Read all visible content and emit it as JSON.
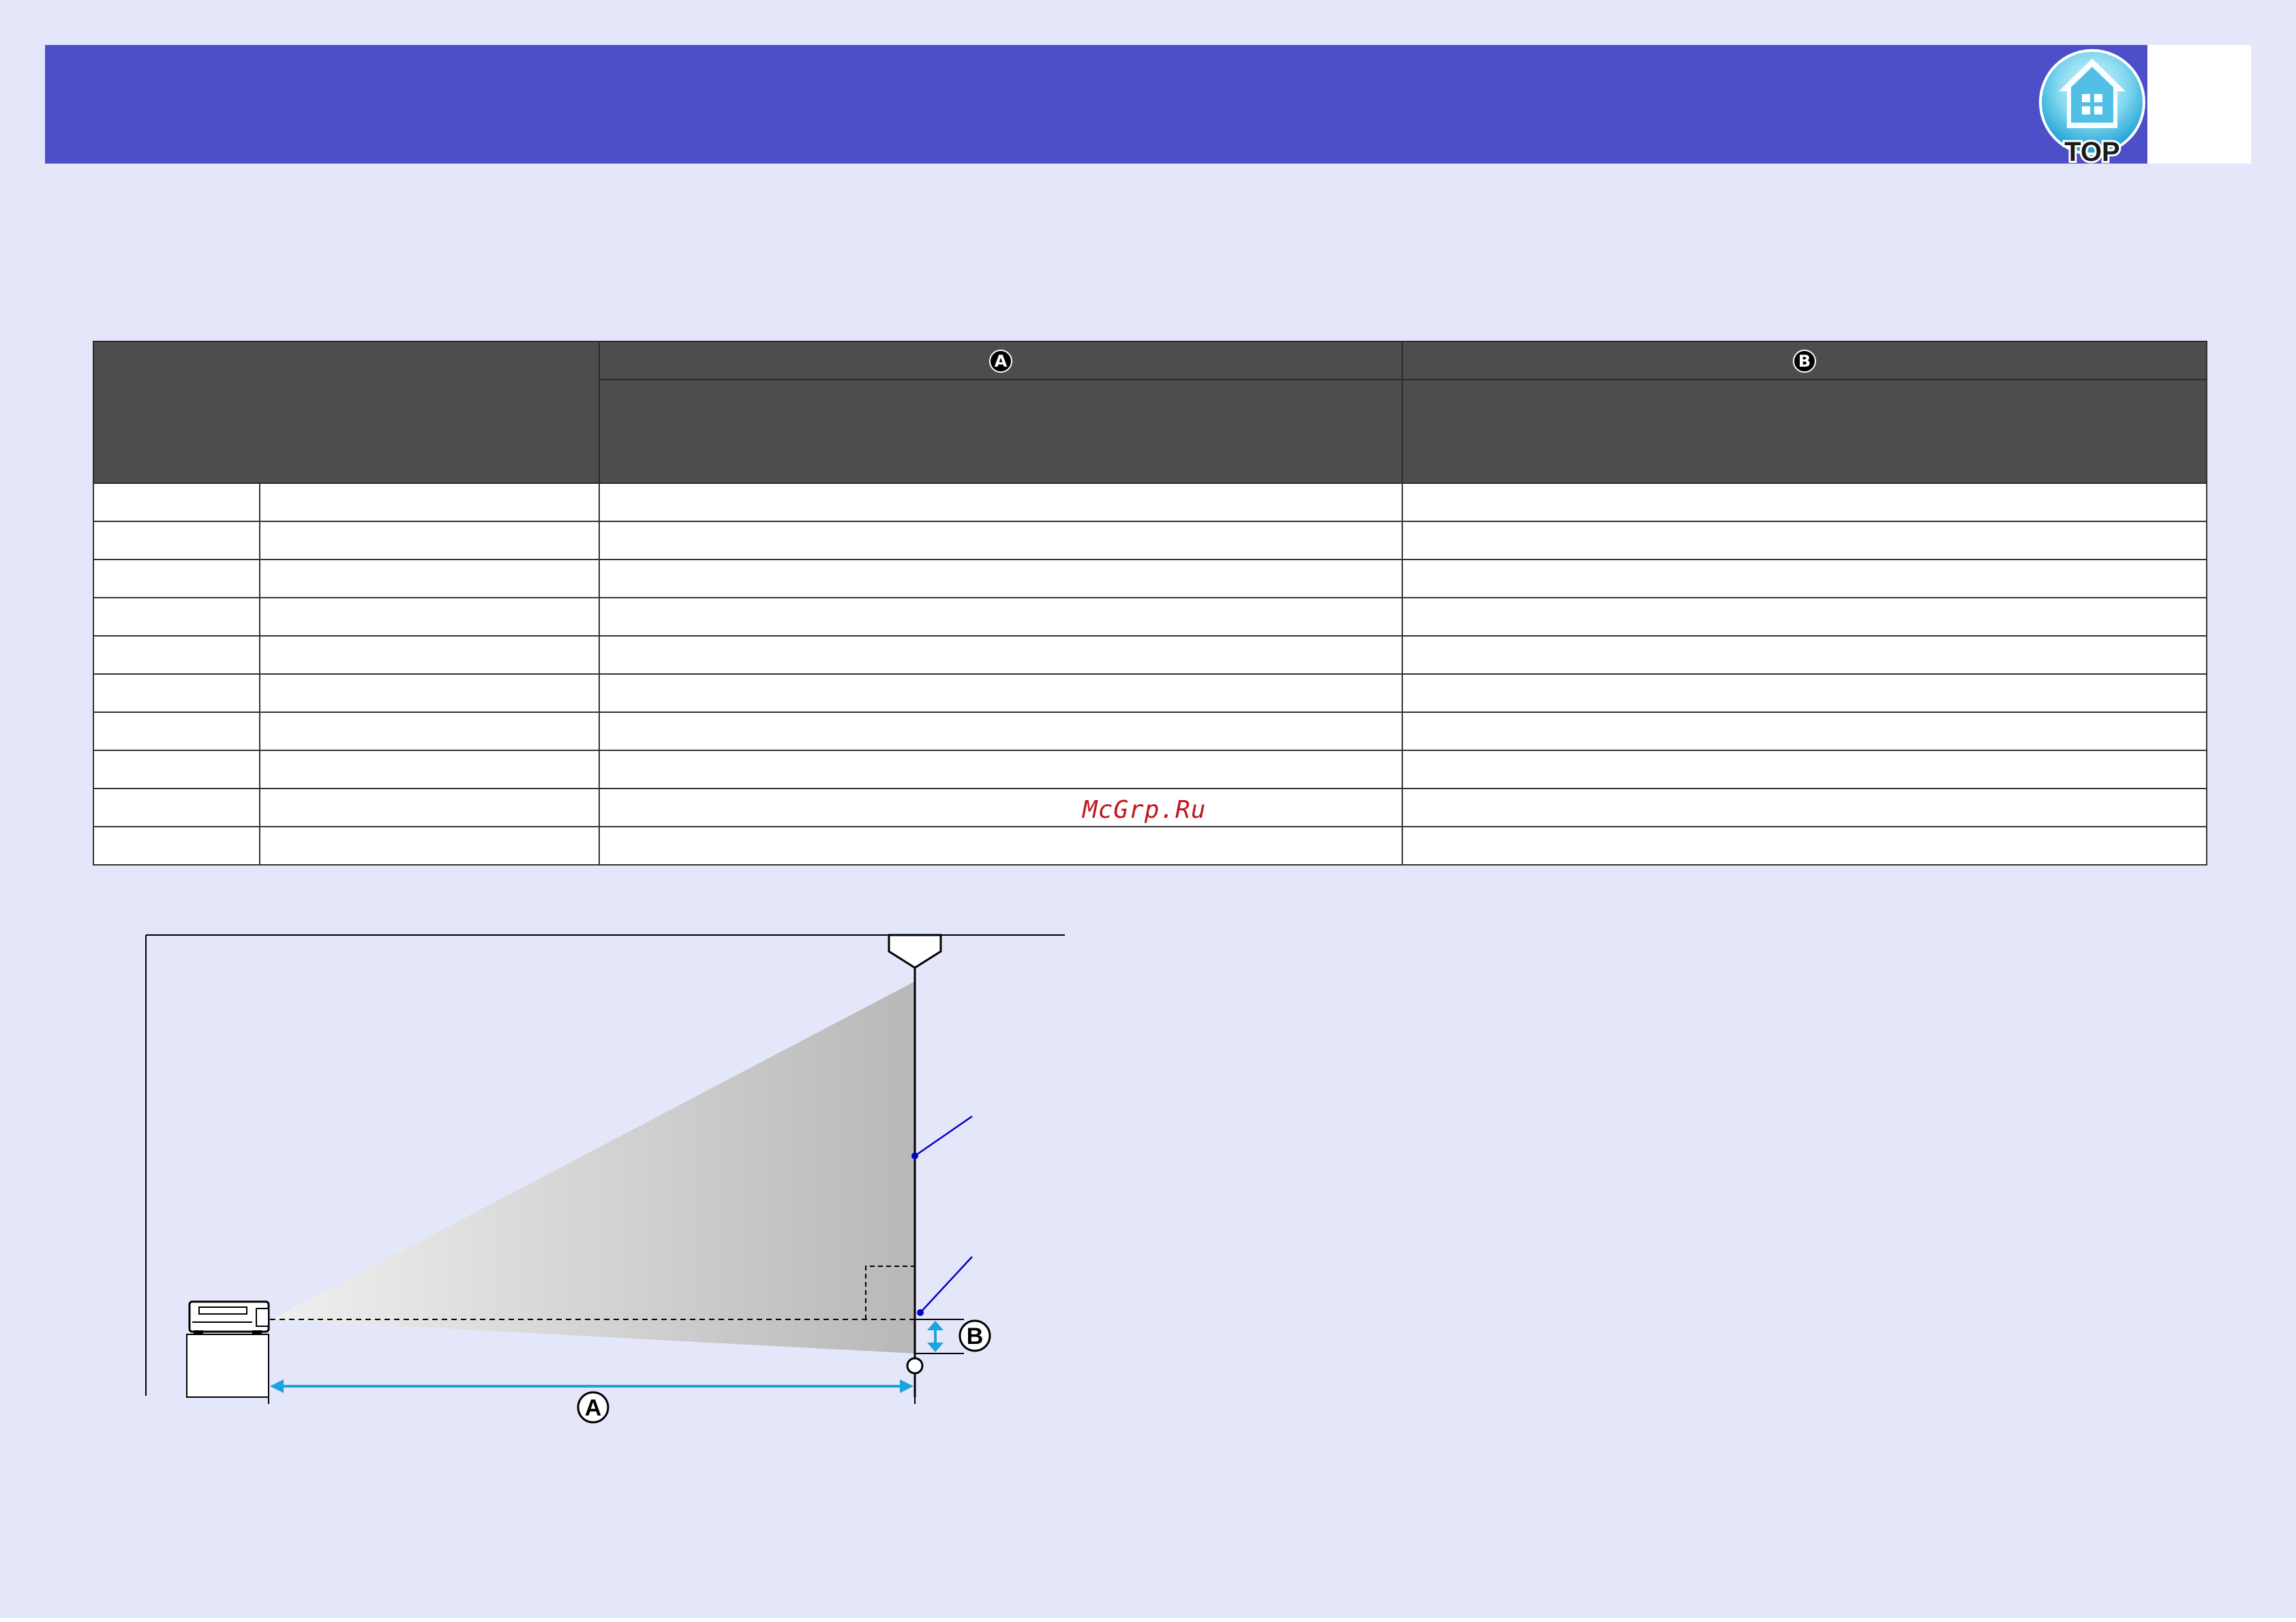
{
  "header": {
    "top_button_label": "TOP"
  },
  "table": {
    "col_a_marker": "A",
    "col_b_marker": "B",
    "rows": [
      [
        "",
        "",
        "",
        ""
      ],
      [
        "",
        "",
        "",
        ""
      ],
      [
        "",
        "",
        "",
        ""
      ],
      [
        "",
        "",
        "",
        ""
      ],
      [
        "",
        "",
        "",
        ""
      ],
      [
        "",
        "",
        "",
        ""
      ],
      [
        "",
        "",
        "",
        ""
      ],
      [
        "",
        "",
        "",
        ""
      ],
      [
        "",
        "",
        "",
        ""
      ],
      [
        "",
        "",
        "",
        ""
      ]
    ]
  },
  "watermark": "McGrp.Ru",
  "diagram": {
    "label_a": "A",
    "label_b": "B"
  },
  "colors": {
    "header": "#4c4fc7",
    "background": "#e4e7fa",
    "table_header": "#4d4d4d",
    "arrow": "#1aa3e0",
    "pointer": "#0000cc"
  }
}
